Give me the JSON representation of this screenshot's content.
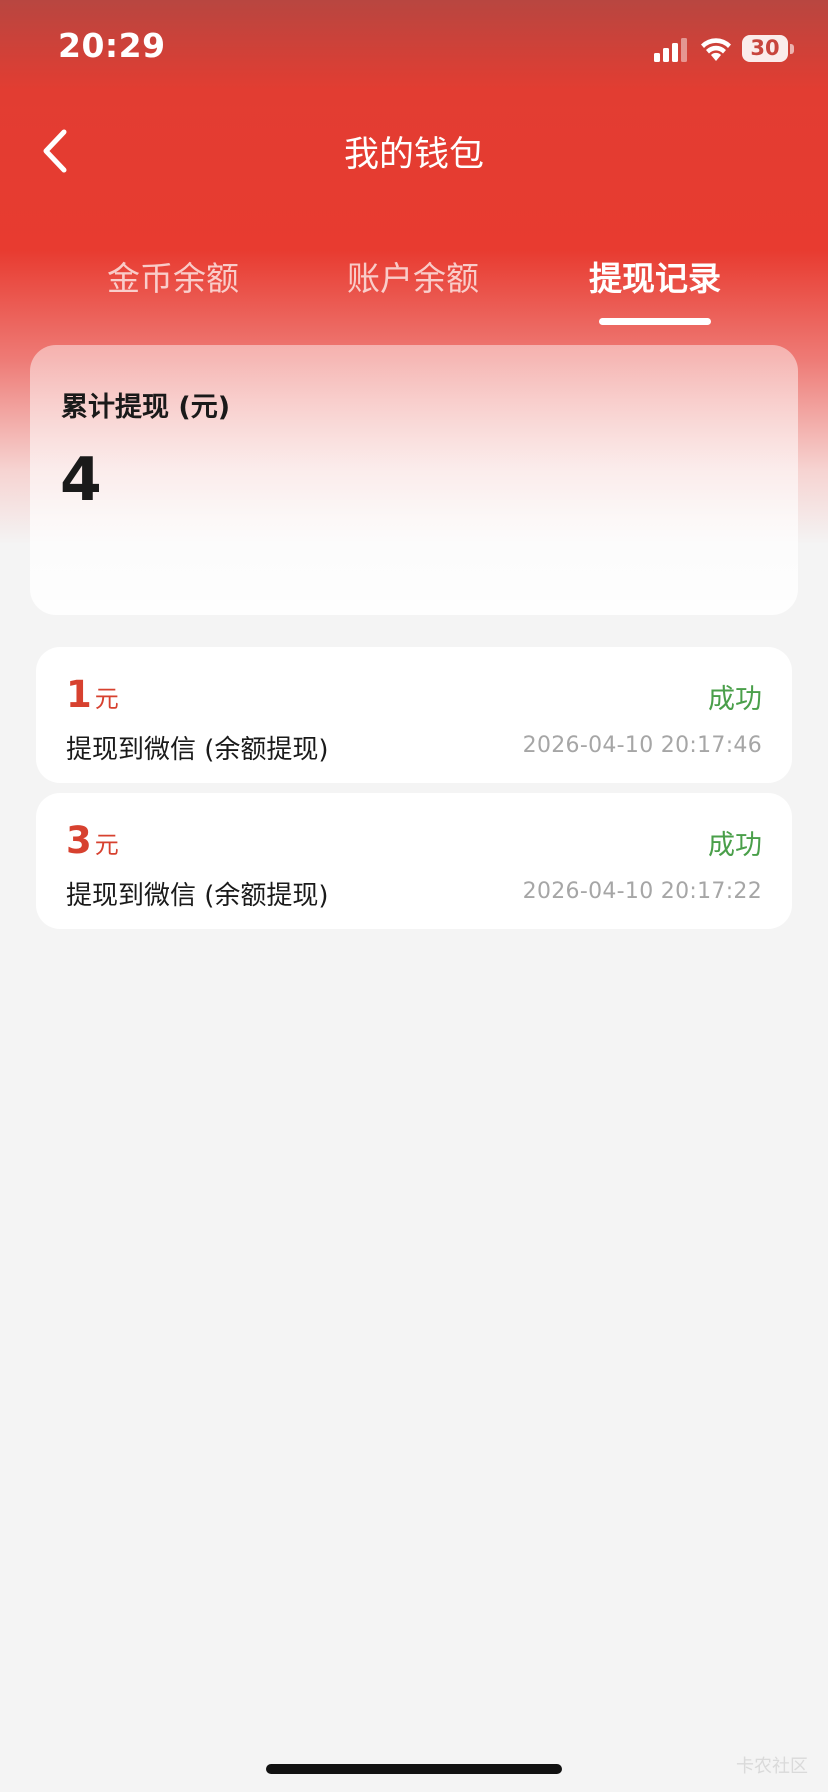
{
  "status_bar": {
    "time": "20:29",
    "battery": "30"
  },
  "header": {
    "title": "我的钱包"
  },
  "tabs": [
    {
      "label": "金币余额",
      "active": false
    },
    {
      "label": "账户余额",
      "active": false
    },
    {
      "label": "提现记录",
      "active": true
    }
  ],
  "summary": {
    "label": "累计提现 (元)",
    "value": "4"
  },
  "records": [
    {
      "amount": "1",
      "unit": "元",
      "status": "成功",
      "description": "提现到微信 (余额提现)",
      "time": "2026-04-10 20:17:46"
    },
    {
      "amount": "3",
      "unit": "元",
      "status": "成功",
      "description": "提现到微信 (余额提现)",
      "time": "2026-04-10 20:17:22"
    }
  ],
  "watermark": "卡农社区",
  "colors": {
    "brand_red": "#e83b30",
    "amount_red": "#d7412f",
    "success_green": "#4a9f4a"
  },
  "icons": {
    "back": "chevron-left-icon",
    "signal": "cellular-signal-icon",
    "wifi": "wifi-icon",
    "battery": "battery-icon"
  }
}
